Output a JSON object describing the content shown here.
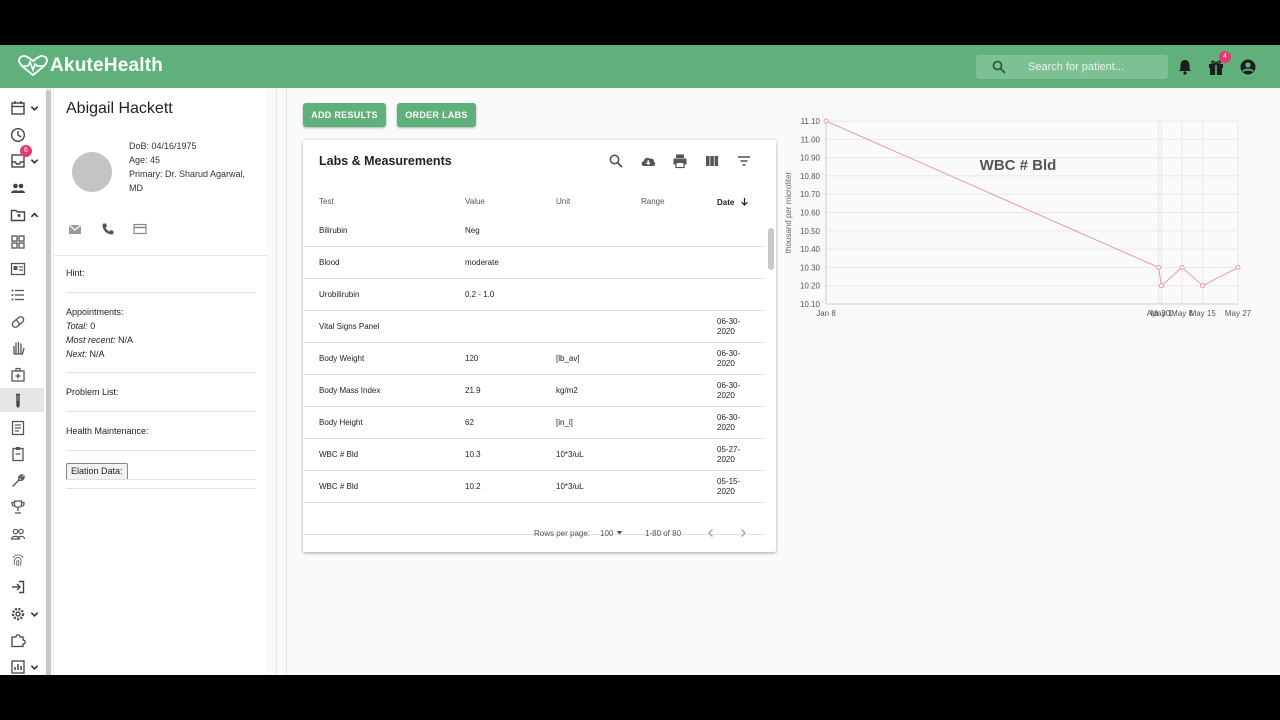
{
  "topbar": {
    "brand": "AkuteHealth",
    "search_placeholder": "Search for patient...",
    "gift_badge": "4"
  },
  "rail": {
    "inbox_badge": "6"
  },
  "patient": {
    "name": "Abigail Hackett",
    "dob": "DoB: 04/16/1975",
    "age": "Age: 45",
    "primary_line1": "Primary: Dr. Sharud Agarwal,",
    "primary_line2": "MD",
    "hint_label": "Hint:",
    "appointments_label": "Appointments:",
    "total_label": "Total:",
    "total_value": "0",
    "recent_label": "Most recent:",
    "recent_value": "N/A",
    "next_label": "Next:",
    "next_value": "N/A",
    "problem_list_label": "Problem List:",
    "health_maintenance_label": "Health Maintenance:",
    "elation_label": "Elation Data:"
  },
  "actions": {
    "add_results": "ADD RESULTS",
    "order_labs": "ORDER LABS"
  },
  "labs": {
    "title": "Labs & Measurements",
    "headers": {
      "test": "Test",
      "value": "Value",
      "unit": "Unit",
      "range": "Range",
      "date": "Date"
    },
    "rows": [
      {
        "test": "Bilirubin",
        "value": "Neg",
        "unit": "",
        "range": "",
        "date": ""
      },
      {
        "test": "Blood",
        "value": "moderate",
        "unit": "",
        "range": "",
        "date": ""
      },
      {
        "test": "Urobilirubin",
        "value": "0.2 - 1.0",
        "unit": "",
        "range": "",
        "date": ""
      },
      {
        "test": "Vital Signs Panel",
        "value": "",
        "unit": "",
        "range": "",
        "date": "06-30-2020"
      },
      {
        "test": "Body Weight",
        "value": "120",
        "unit": "[lb_av]",
        "range": "",
        "date": "06-30-2020"
      },
      {
        "test": "Body Mass Index",
        "value": "21.9",
        "unit": "kg/m2",
        "range": "",
        "date": "06-30-2020"
      },
      {
        "test": "Body Height",
        "value": "62",
        "unit": "[in_i]",
        "range": "",
        "date": "06-30-2020"
      },
      {
        "test": "WBC # Bld",
        "value": "10.3",
        "unit": "10*3/uL",
        "range": "",
        "date": "05-27-2020"
      },
      {
        "test": "WBC # Bld",
        "value": "10.2",
        "unit": "10*3/uL",
        "range": "",
        "date": "05-15-2020"
      }
    ],
    "rows_per_page_label": "Rows per page:",
    "rows_per_page_value": "100",
    "pagination": "1-80 of 80"
  },
  "chart_data": {
    "type": "line",
    "title": "WBC # Bld",
    "ylabel": "thousand per microliter",
    "xlabel": "",
    "ylim": [
      10.1,
      11.1
    ],
    "yticks": [
      "11.10",
      "11.00",
      "10.90",
      "10.80",
      "10.70",
      "10.60",
      "10.50",
      "10.40",
      "10.30",
      "10.20",
      "10.10"
    ],
    "xticks": [
      "Jan 8",
      "Apr 30",
      "May 1",
      "May 8",
      "May 15",
      "May 27"
    ],
    "grid": true,
    "colors": {
      "line": "#e89aa8"
    },
    "series": [
      {
        "x": [
          "Jan 8",
          "Apr 30",
          "May 1",
          "May 8",
          "May 15",
          "May 27"
        ],
        "values": [
          11.1,
          10.3,
          10.2,
          10.3,
          10.2,
          10.3
        ]
      }
    ]
  },
  "colors": {
    "brand": "#5fb07b",
    "badge": "#e53971"
  }
}
